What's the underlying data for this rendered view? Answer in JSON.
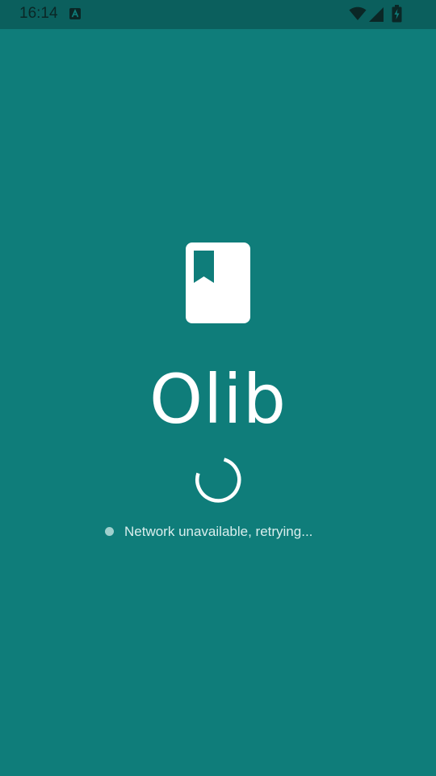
{
  "status_bar": {
    "time": "16:14",
    "icons": [
      "android-notification-icon",
      "wifi-icon",
      "signal-icon",
      "battery-charging-icon"
    ]
  },
  "splash": {
    "logo_icon": "bookmark-book-icon",
    "app_name": "Olib",
    "loading_indicator": "spinner-icon",
    "status_indicator": "status-dot-icon",
    "status_message": "Network unavailable, retrying..."
  },
  "colors": {
    "background": "#0f7d7a",
    "status_bar": "#0b5f5d",
    "foreground": "#ffffff",
    "dot": "#9fd0cd"
  }
}
